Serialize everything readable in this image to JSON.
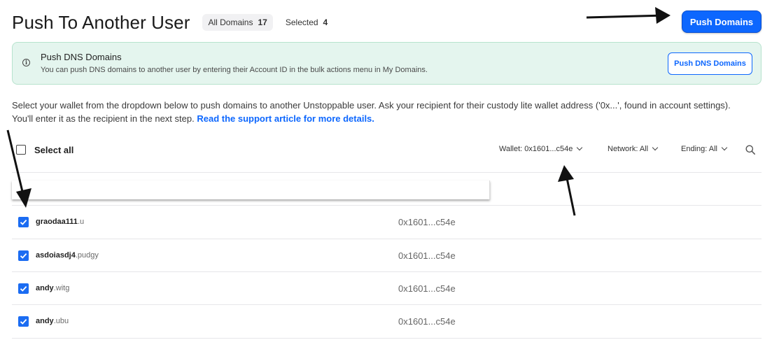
{
  "header": {
    "title": "Push To Another User",
    "all_domains_label": "All Domains",
    "all_domains_count": "17",
    "selected_label": "Selected",
    "selected_count": "4",
    "push_button": "Push Domains"
  },
  "alert": {
    "icon": "info-icon",
    "title": "Push DNS Domains",
    "text": "You can push DNS domains to another user by entering their Account ID in the bulk actions menu in My Domains.",
    "button": "Push DNS Domains"
  },
  "description": {
    "text": "Select your wallet from the dropdown below to push domains to another Unstoppable user. Ask your recipient for their custody lite wallet address ('0x...', found in account settings). You'll enter it as the recipient in the next step. ",
    "link": "Read the support article for more details."
  },
  "toolbar": {
    "select_all": "Select all",
    "wallet_filter": "Wallet: 0x1601...c54e",
    "network_filter": "Network: All",
    "ending_filter": "Ending: All",
    "search_icon": "search-icon"
  },
  "domains": [
    {
      "label": "graodaa111",
      "tld": ".u",
      "owner": "0x1601...c54e",
      "checked": true
    },
    {
      "label": "asdoiasdj4",
      "tld": ".pudgy",
      "owner": "0x1601...c54e",
      "checked": true
    },
    {
      "label": "andy",
      "tld": ".witg",
      "owner": "0x1601...c54e",
      "checked": true
    },
    {
      "label": "andy",
      "tld": ".ubu",
      "owner": "0x1601...c54e",
      "checked": true
    }
  ],
  "colors": {
    "accent": "#0d67fe",
    "alert_bg": "#e4f5ee",
    "checkbox": "#1b6cf2"
  }
}
